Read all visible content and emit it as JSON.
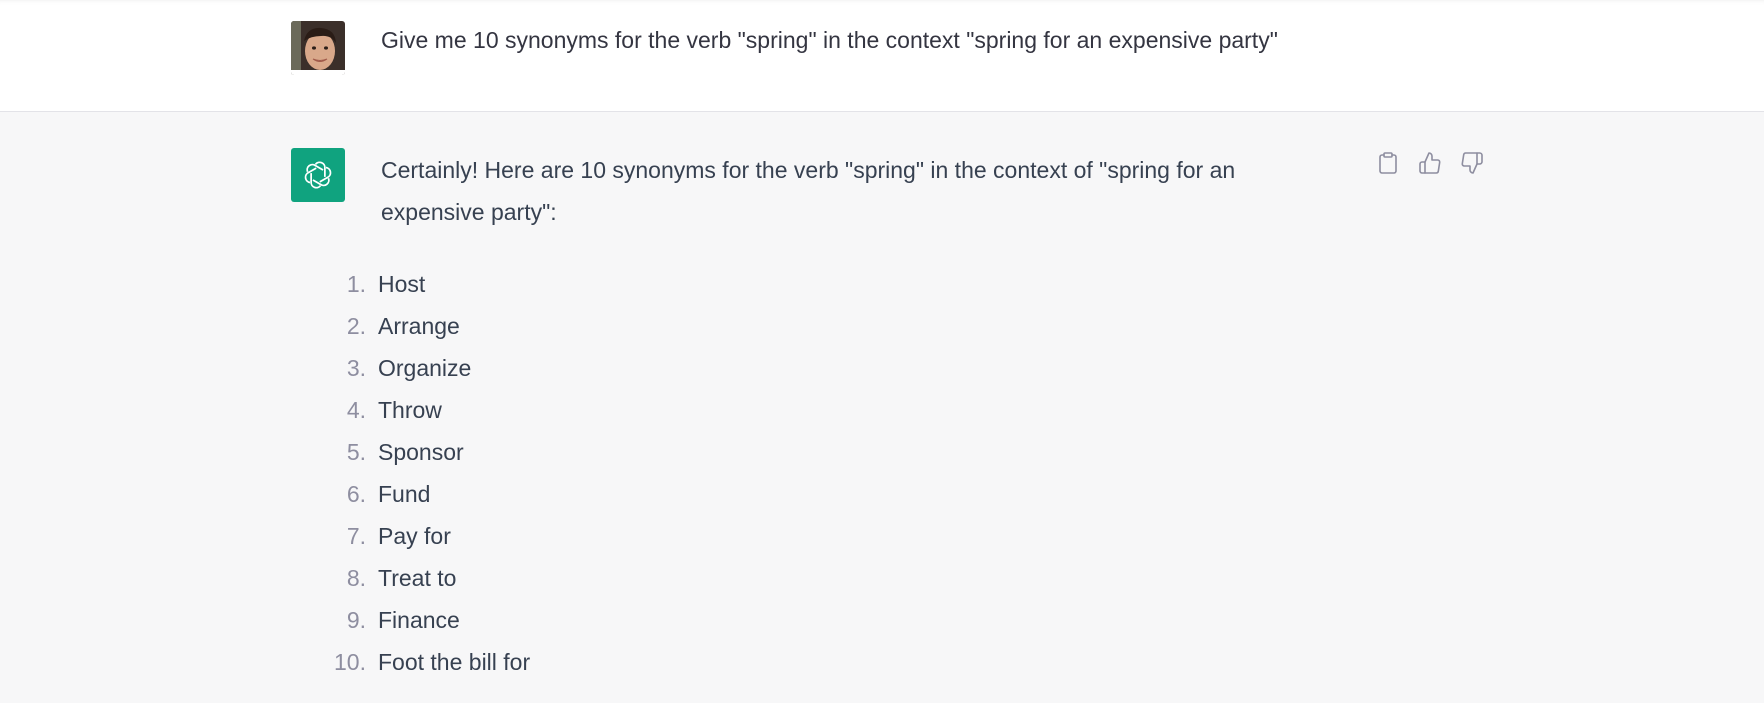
{
  "user_message": {
    "text": "Give me 10 synonyms for the verb \"spring\" in the context \"spring for an expensive party\""
  },
  "assistant_message": {
    "intro": "Certainly! Here are 10 synonyms for the verb \"spring\" in the context of \"spring for an expensive party\":",
    "items": [
      {
        "num": "1.",
        "text": "Host"
      },
      {
        "num": "2.",
        "text": "Arrange"
      },
      {
        "num": "3.",
        "text": "Organize"
      },
      {
        "num": "4.",
        "text": "Throw"
      },
      {
        "num": "5.",
        "text": "Sponsor"
      },
      {
        "num": "6.",
        "text": "Fund"
      },
      {
        "num": "7.",
        "text": "Pay for"
      },
      {
        "num": "8.",
        "text": "Treat to"
      },
      {
        "num": "9.",
        "text": "Finance"
      },
      {
        "num": "10.",
        "text": "Foot the bill for"
      }
    ]
  },
  "icons": {
    "copy": "clipboard-icon",
    "like": "thumbs-up-icon",
    "dislike": "thumbs-down-icon",
    "assistant_logo": "openai-logo-icon",
    "user_avatar": "user-avatar-photo"
  },
  "colors": {
    "assistant_avatar_bg": "#10a37f",
    "assistant_row_bg": "#f7f7f8",
    "user_row_bg": "#ffffff",
    "text": "#374151",
    "list_number": "#8e8ea0",
    "icon": "#8e8ea0"
  }
}
